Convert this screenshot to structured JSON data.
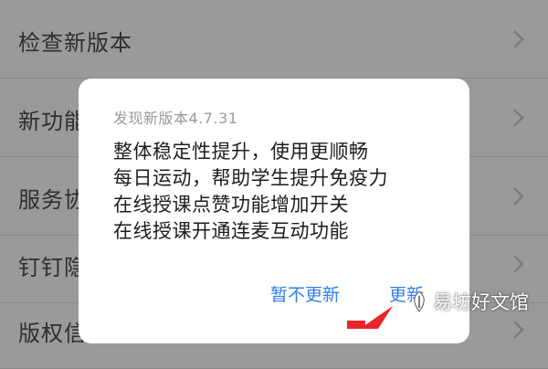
{
  "settings": {
    "items": [
      {
        "label": "检查新版本"
      },
      {
        "label": "新功能"
      },
      {
        "label": "服务协"
      },
      {
        "label": "钉钉隐"
      },
      {
        "label": "版权信"
      }
    ]
  },
  "dialog": {
    "title": "发现新版本4.7.31",
    "notes": [
      "整体稳定性提升，使用更顺畅",
      "每日运动，帮助学生提升免疫力",
      "在线授课点赞功能增加开关",
      "在线授课开通连麦互动功能"
    ],
    "later_label": "暂不更新",
    "update_label": "更新"
  },
  "watermark": {
    "text": "易坊好文馆"
  },
  "colors": {
    "accent": "#2f7fe8",
    "arrow": "#e8262a",
    "overlay_bg": "#9a9a9a",
    "dialog_bg": "#ffffff"
  }
}
